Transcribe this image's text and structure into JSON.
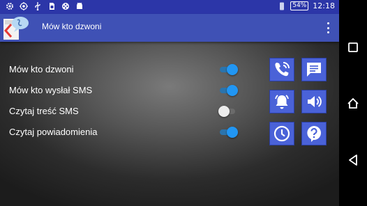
{
  "status_bar": {
    "battery_percent": "54%",
    "time": "12:18",
    "left_icons": [
      "settings-icon",
      "gps-icon",
      "usb-icon",
      "sim-icon",
      "film-icon",
      "android-icon"
    ],
    "right_icons": [
      "phone-vibrate-icon",
      "battery-icon"
    ]
  },
  "app_bar": {
    "title": "Mów kto dzwoni",
    "app_icon": "app-logo-icon",
    "menu_icon": "overflow-menu-icon"
  },
  "settings": [
    {
      "label": "Mów kto dzwoni",
      "enabled": true
    },
    {
      "label": "Mów kto wysłał SMS",
      "enabled": true
    },
    {
      "label": "Czytaj treść SMS",
      "enabled": false
    },
    {
      "label": "Czytaj powiadomienia",
      "enabled": true
    }
  ],
  "shortcut_buttons": [
    {
      "icon": "phone-ringing-icon"
    },
    {
      "icon": "message-icon"
    },
    {
      "icon": "alarm-bell-icon"
    },
    {
      "icon": "volume-icon"
    },
    {
      "icon": "clock-icon"
    },
    {
      "icon": "help-icon"
    }
  ],
  "colors": {
    "status_bar": "#2c36a8",
    "app_bar": "#3f51b5",
    "tile": "#4a62d8",
    "toggle_on": "#2196f3"
  },
  "nav_bar": {
    "buttons": [
      "recent-apps-icon",
      "home-icon",
      "back-icon"
    ]
  }
}
